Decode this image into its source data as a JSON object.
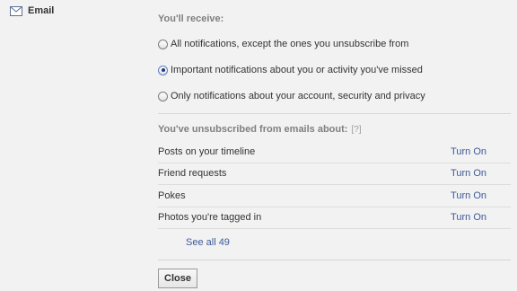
{
  "sidebar": {
    "email_label": "Email",
    "icon": "mail-icon"
  },
  "receive": {
    "title": "You'll receive:",
    "options": [
      {
        "label": "All notifications, except the ones you unsubscribe from",
        "checked": false
      },
      {
        "label": "Important notifications about you or activity you've missed",
        "checked": true
      },
      {
        "label": "Only notifications about your account, security and privacy",
        "checked": false
      }
    ]
  },
  "unsubscribed": {
    "title": "You've unsubscribed from emails about:",
    "help": "[?]",
    "items": [
      {
        "label": "Posts on your timeline",
        "action": "Turn On"
      },
      {
        "label": "Friend requests",
        "action": "Turn On"
      },
      {
        "label": "Pokes",
        "action": "Turn On"
      },
      {
        "label": "Photos you're tagged in",
        "action": "Turn On"
      }
    ],
    "see_all": "See all 49"
  },
  "close_label": "Close",
  "colors": {
    "link": "#3b5998",
    "section_title": "#7f7f7f",
    "background": "#f2f2f2"
  }
}
